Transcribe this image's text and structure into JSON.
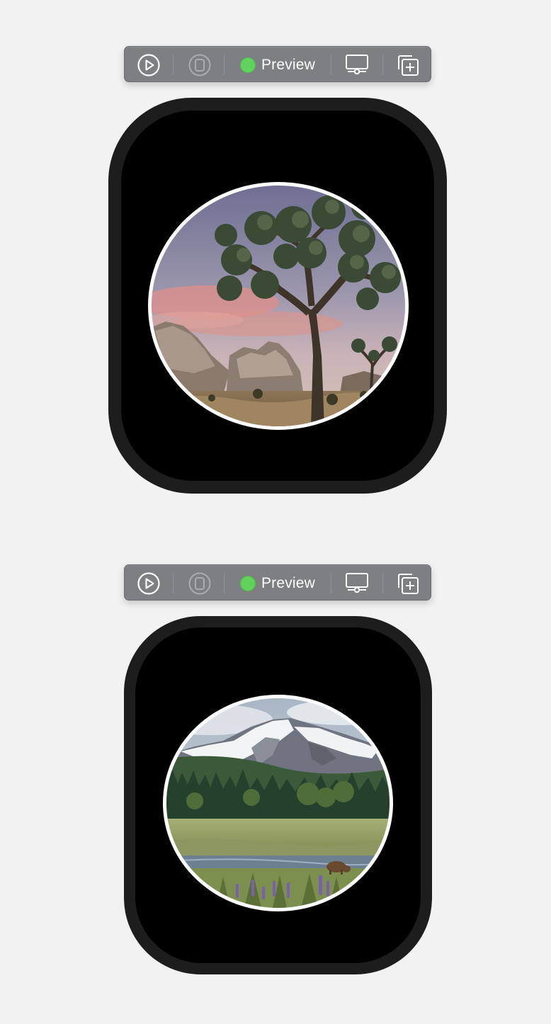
{
  "previews": [
    {
      "toolbar": {
        "live_button": "play-circle-icon",
        "device_button": "watch-device-icon",
        "status_label": "Preview",
        "status_color": "#5fd35b",
        "settings_button": "device-settings-icon",
        "duplicate_button": "duplicate-add-icon"
      },
      "image": "joshua-tree-desert-photo"
    },
    {
      "toolbar": {
        "live_button": "play-circle-icon",
        "device_button": "watch-device-icon",
        "status_label": "Preview",
        "status_color": "#5fd35b",
        "settings_button": "device-settings-icon",
        "duplicate_button": "duplicate-add-icon"
      },
      "image": "mountain-meadow-bear-photo"
    }
  ]
}
